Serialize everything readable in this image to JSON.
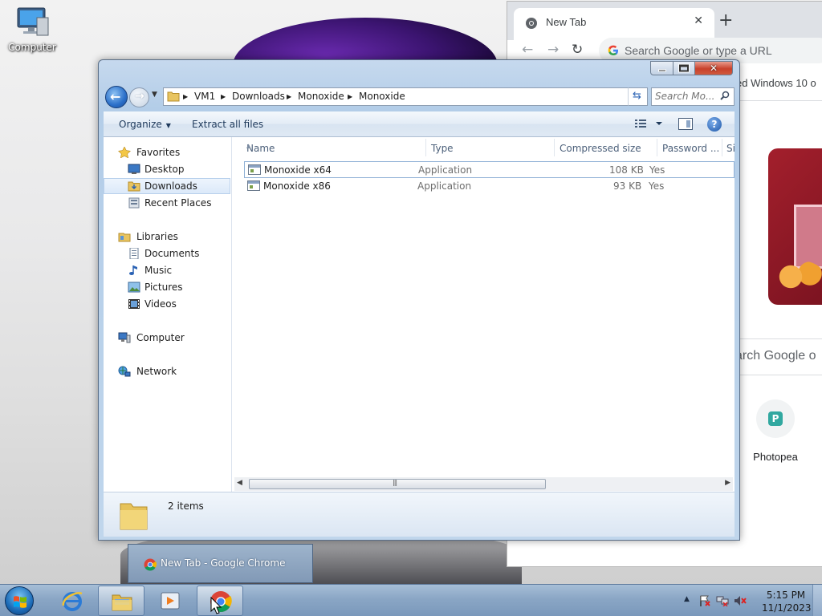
{
  "desktop": {
    "icons": [
      {
        "label": "Computer",
        "icon": "computer-icon"
      }
    ]
  },
  "chrome": {
    "tab_title": "New Tab",
    "omnibox_placeholder": "Search Google or type a URL",
    "bookmark_text": "ed Windows 10 o",
    "search_text": "arch Google o",
    "shortcut_label": "Photopea"
  },
  "explorer": {
    "breadcrumbs": [
      "VM1",
      "Downloads",
      "Monoxide",
      "Monoxide"
    ],
    "search_placeholder": "Search Mo...",
    "toolbar": {
      "organize_label": "Organize",
      "extract_label": "Extract all files"
    },
    "nav": {
      "favorites": {
        "label": "Favorites",
        "items": [
          {
            "label": "Desktop",
            "icon": "desktop-icon"
          },
          {
            "label": "Downloads",
            "icon": "downloads-folder-icon"
          },
          {
            "label": "Recent Places",
            "icon": "recent-places-icon"
          }
        ]
      },
      "libraries": {
        "label": "Libraries",
        "items": [
          {
            "label": "Documents",
            "icon": "documents-icon"
          },
          {
            "label": "Music",
            "icon": "music-icon"
          },
          {
            "label": "Pictures",
            "icon": "pictures-icon"
          },
          {
            "label": "Videos",
            "icon": "videos-icon"
          }
        ]
      },
      "computer": {
        "label": "Computer"
      },
      "network": {
        "label": "Network"
      },
      "selected": "Downloads"
    },
    "columns": [
      "Name",
      "Type",
      "Compressed size",
      "Password ...",
      "Si"
    ],
    "files": [
      {
        "name": "Monoxide x64",
        "type": "Application",
        "compressed_size": "108 KB",
        "password": "Yes"
      },
      {
        "name": "Monoxide x86",
        "type": "Application",
        "compressed_size": "93 KB",
        "password": "Yes"
      }
    ],
    "status": {
      "count": "2 items"
    }
  },
  "taskbar": {
    "popup_label": "New Tab - Google Chrome",
    "pinned": [
      "internet-explorer-icon",
      "windows-explorer-icon",
      "media-player-icon",
      "chrome-icon"
    ],
    "clock": {
      "time": "5:15 PM",
      "date": "11/1/2023"
    }
  },
  "colors": {
    "selection_border": "#8fb0d6",
    "close_button": "#c8412c",
    "column_header_text": "#4c607a"
  }
}
